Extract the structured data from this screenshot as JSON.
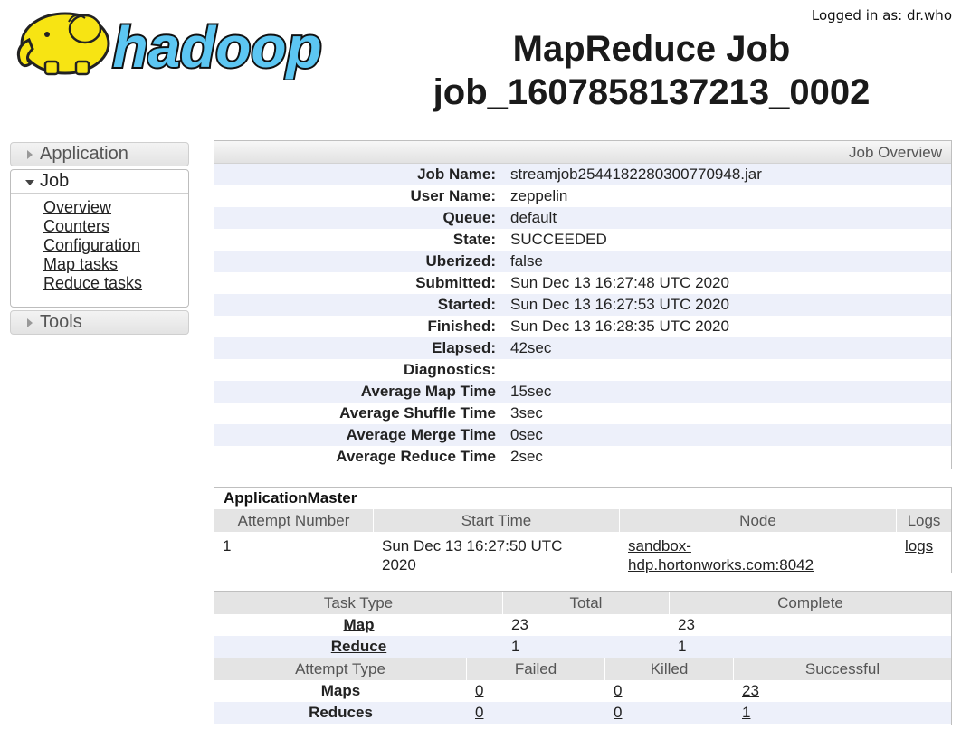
{
  "header": {
    "brand": "hadoop",
    "logged_in": "Logged in as: dr.who",
    "title_line1": "MapReduce Job",
    "title_line2": "job_1607858137213_0002"
  },
  "nav": {
    "application": "Application",
    "job": "Job",
    "job_links": [
      "Overview",
      "Counters",
      "Configuration",
      "Map tasks",
      "Reduce tasks"
    ],
    "tools": "Tools"
  },
  "overview": {
    "header": "Job Overview",
    "rows": [
      {
        "label": "Job Name:",
        "value": "streamjob2544182280300770948.jar"
      },
      {
        "label": "User Name:",
        "value": "zeppelin"
      },
      {
        "label": "Queue:",
        "value": "default"
      },
      {
        "label": "State:",
        "value": "SUCCEEDED"
      },
      {
        "label": "Uberized:",
        "value": "false"
      },
      {
        "label": "Submitted:",
        "value": "Sun Dec 13 16:27:48 UTC 2020"
      },
      {
        "label": "Started:",
        "value": "Sun Dec 13 16:27:53 UTC 2020"
      },
      {
        "label": "Finished:",
        "value": "Sun Dec 13 16:28:35 UTC 2020"
      },
      {
        "label": "Elapsed:",
        "value": "42sec"
      },
      {
        "label": "Diagnostics:",
        "value": ""
      },
      {
        "label": "Average Map Time",
        "value": "15sec"
      },
      {
        "label": "Average Shuffle Time",
        "value": "3sec"
      },
      {
        "label": "Average Merge Time",
        "value": "0sec"
      },
      {
        "label": "Average Reduce Time",
        "value": "2sec"
      }
    ]
  },
  "application_master": {
    "title": "ApplicationMaster",
    "columns": [
      "Attempt Number",
      "Start Time",
      "Node",
      "Logs"
    ],
    "row": {
      "attempt": "1",
      "start_time_line1": "Sun Dec 13 16:27:50 UTC",
      "start_time_line2": "2020",
      "node_line1": "sandbox-",
      "node_line2": "hdp.hortonworks.com:8042",
      "logs": "logs"
    }
  },
  "task_summary": {
    "columns": [
      "Task Type",
      "Total",
      "Complete"
    ],
    "rows": [
      {
        "type": "Map",
        "total": "23",
        "complete": "23"
      },
      {
        "type": "Reduce",
        "total": "1",
        "complete": "1"
      }
    ]
  },
  "attempt_summary": {
    "columns": [
      "Attempt Type",
      "Failed",
      "Killed",
      "Successful"
    ],
    "rows": [
      {
        "type": "Maps",
        "failed": "0",
        "killed": "0",
        "successful": "23"
      },
      {
        "type": "Reduces",
        "failed": "0",
        "killed": "0",
        "successful": "1"
      }
    ]
  },
  "colors": {
    "row_stripe": "#edf0fa",
    "logo_yellow": "#f7e413",
    "logo_text": "#5cc6f2"
  }
}
